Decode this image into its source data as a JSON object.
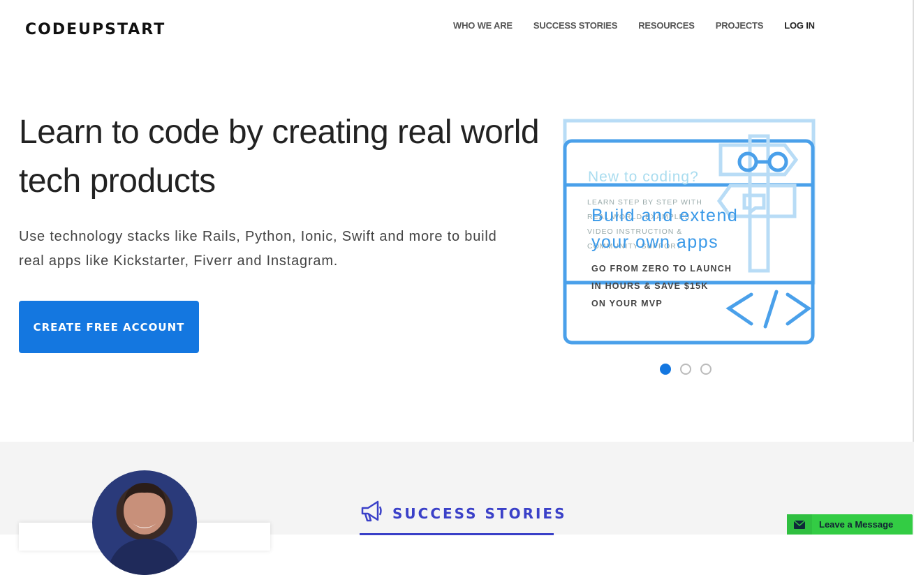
{
  "header": {
    "logo": "CODEUPSTART",
    "nav": [
      "WHO WE ARE",
      "SUCCESS STORIES",
      "RESOURCES",
      "PROJECTS",
      "LOG IN"
    ]
  },
  "hero": {
    "headline": "Learn to code by creating real world tech products",
    "subtext": "Use technology stacks like Rails, Python, Ionic, Swift and more to build real apps like Kickstarter, Fiverr and Instagram.",
    "cta": "CREATE FREE ACCOUNT"
  },
  "slider": {
    "ghost_title": "New to coding?",
    "ghost_lines": [
      "LEARN STEP BY STEP WITH",
      "REAL WORLD EXAMPLES,",
      "VIDEO INSTRUCTION &",
      "COMMUNITY SUPPORT"
    ],
    "title_lines": [
      "Build and extend",
      "your own apps"
    ],
    "body_lines": [
      "GO FROM ZERO TO LAUNCH",
      "IN HOURS & SAVE $15K",
      "ON YOUR MVP"
    ],
    "dots": 3,
    "active_dot": 0
  },
  "success": {
    "title": "SUCCESS STORIES"
  },
  "chat": {
    "label": "Leave a Message"
  },
  "colors": {
    "primary": "#1477e0",
    "success_title": "#3a40c8",
    "chat": "#33cc44"
  },
  "icons": [
    "megaphone-icon",
    "envelope-icon",
    "signpost-icon",
    "code-icon",
    "binoculars-icon",
    "chat-bubble-icon"
  ]
}
